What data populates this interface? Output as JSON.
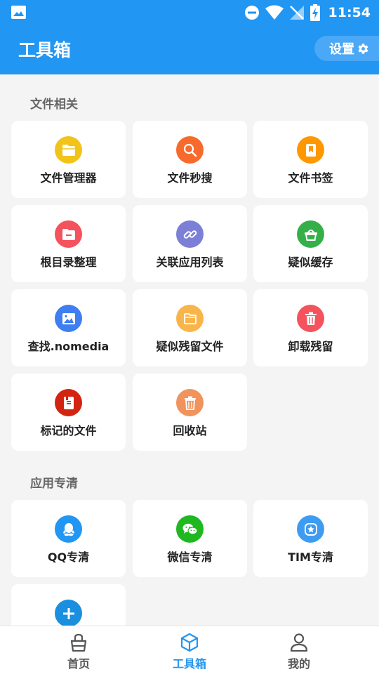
{
  "status_bar": {
    "time": "11:54"
  },
  "app_bar": {
    "title": "工具箱",
    "settings_label": "设置"
  },
  "sections": {
    "file": {
      "title": "文件相关",
      "items": [
        {
          "label": "文件管理器",
          "icon": "folder-icon",
          "color": "#f2c319"
        },
        {
          "label": "文件秒搜",
          "icon": "search-icon",
          "color": "#f76a2c"
        },
        {
          "label": "文件书签",
          "icon": "bookmark-icon",
          "color": "#ff9800"
        },
        {
          "label": "根目录整理",
          "icon": "folder-minus-icon",
          "color": "#f4525c"
        },
        {
          "label": "关联应用列表",
          "icon": "link-icon",
          "color": "#7b80d6"
        },
        {
          "label": "疑似缓存",
          "icon": "basket-icon",
          "color": "#35b048"
        },
        {
          "label": "查找.nomedia",
          "icon": "image-icon",
          "color": "#3f7ef1"
        },
        {
          "label": "疑似残留文件",
          "icon": "folder-outline-icon",
          "color": "#f9b549"
        },
        {
          "label": "卸载残留",
          "icon": "trash-icon",
          "color": "#f4525c"
        },
        {
          "label": "标记的文件",
          "icon": "marked-file-icon",
          "color": "#d32411"
        },
        {
          "label": "回收站",
          "icon": "recycle-bin-icon",
          "color": "#f0935c"
        }
      ]
    },
    "app": {
      "title": "应用专清",
      "items": [
        {
          "label": "QQ专清",
          "icon": "qq-icon",
          "color": "#2196f3"
        },
        {
          "label": "微信专清",
          "icon": "wechat-icon",
          "color": "#1fb820"
        },
        {
          "label": "TIM专清",
          "icon": "tim-icon",
          "color": "#3d9cf2"
        },
        {
          "label": "",
          "icon": "plus-icon",
          "color": "#1a8fe0"
        }
      ]
    }
  },
  "bottom_nav": [
    {
      "label": "首页",
      "icon": "home-icon"
    },
    {
      "label": "工具箱",
      "icon": "toolbox-icon",
      "active": true
    },
    {
      "label": "我的",
      "icon": "profile-icon"
    }
  ]
}
